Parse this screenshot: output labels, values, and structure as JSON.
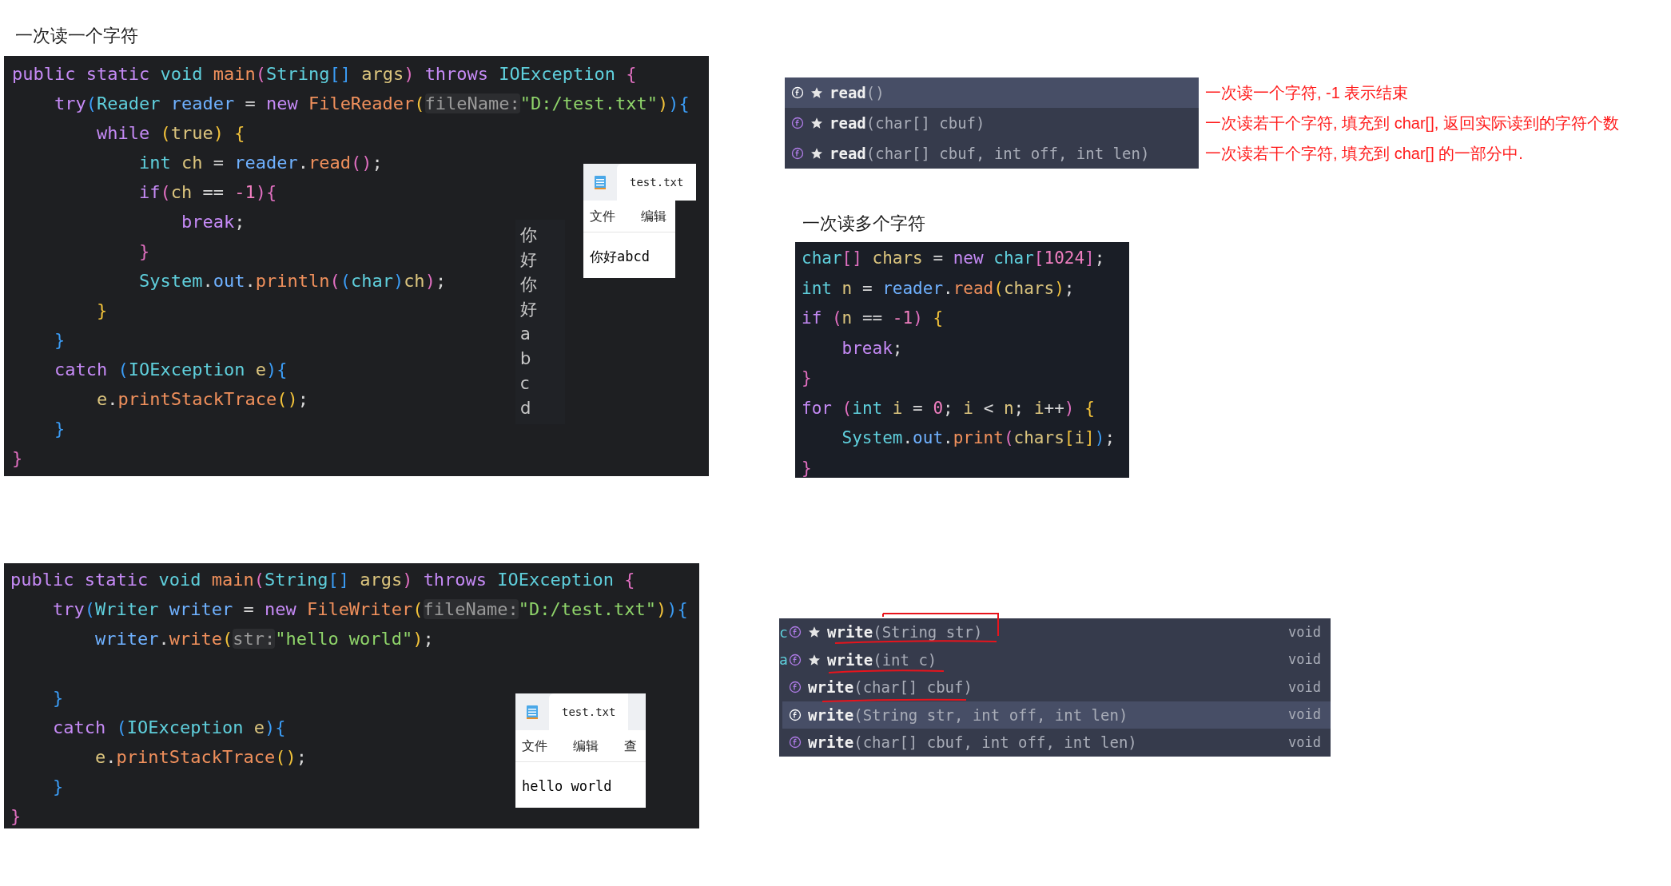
{
  "read_single": {
    "heading": "一次读一个字符",
    "code": [
      {
        "kind": "code",
        "tokens": [
          {
            "kind": "code",
            "s": "public static ",
            "color": "#c58af5"
          },
          {
            "kind": "code",
            "s": "void ",
            "color": "#5fcfdc"
          },
          {
            "kind": "code",
            "s": "main",
            "color": "#f0905c"
          },
          {
            "kind": "code",
            "s": "(",
            "color": "#e06fc0"
          },
          {
            "kind": "code",
            "s": "String",
            "color": "#5fcfdc"
          },
          {
            "kind": "code",
            "s": "[] ",
            "color": "#3b9cf5"
          },
          {
            "kind": "code",
            "s": "args",
            "color": "#dcc57e"
          },
          {
            "kind": "code",
            "s": ") ",
            "color": "#e06fc0"
          },
          {
            "kind": "code",
            "s": "throws ",
            "color": "#c58af5"
          },
          {
            "kind": "code",
            "s": "IOException ",
            "color": "#5fcfdc"
          },
          {
            "kind": "code",
            "s": "{",
            "color": "#e06fc0"
          }
        ]
      },
      {
        "kind": "code",
        "tokens": [
          {
            "kind": "code",
            "s": "    try",
            "color": "#c58af5"
          },
          {
            "kind": "code",
            "s": "(",
            "color": "#3b9cf5"
          },
          {
            "kind": "code",
            "s": "Reader ",
            "color": "#5fcfdc"
          },
          {
            "kind": "code",
            "s": "reader ",
            "color": "#6fb1ff"
          },
          {
            "kind": "code",
            "s": "= ",
            "color": "#d8d8d8"
          },
          {
            "kind": "code",
            "s": "new ",
            "color": "#c58af5"
          },
          {
            "kind": "code",
            "s": "FileReader",
            "color": "#f0905c"
          },
          {
            "kind": "code",
            "s": "(",
            "color": "#f2c23a"
          },
          {
            "kind": "hint",
            "s": "fileName:",
            "color": "#9a9a9a"
          },
          {
            "kind": "code",
            "s": "\"D:/test.txt\"",
            "color": "#8fd46a"
          },
          {
            "kind": "code",
            "s": ")",
            "color": "#f2c23a"
          },
          {
            "kind": "code",
            "s": "){",
            "color": "#3b9cf5"
          }
        ]
      },
      {
        "kind": "code",
        "tokens": [
          {
            "kind": "code",
            "s": "        while ",
            "color": "#c58af5"
          },
          {
            "kind": "code",
            "s": "(",
            "color": "#f2c23a"
          },
          {
            "kind": "code",
            "s": "true",
            "color": "#dcc57e"
          },
          {
            "kind": "code",
            "s": ") {",
            "color": "#f2c23a"
          }
        ]
      },
      {
        "kind": "code",
        "tokens": [
          {
            "kind": "code",
            "s": "            int ",
            "color": "#5fcfdc"
          },
          {
            "kind": "code",
            "s": "ch ",
            "color": "#dcc57e"
          },
          {
            "kind": "code",
            "s": "= ",
            "color": "#d8d8d8"
          },
          {
            "kind": "code",
            "s": "reader",
            "color": "#6fb1ff"
          },
          {
            "kind": "code",
            "s": ".",
            "color": "#d8d8d8"
          },
          {
            "kind": "code",
            "s": "read",
            "color": "#f0905c"
          },
          {
            "kind": "code",
            "s": "()",
            "color": "#e06fc0"
          },
          {
            "kind": "code",
            "s": ";",
            "color": "#d8d8d8"
          }
        ]
      },
      {
        "kind": "code",
        "tokens": [
          {
            "kind": "code",
            "s": "            if",
            "color": "#c58af5"
          },
          {
            "kind": "code",
            "s": "(",
            "color": "#e06fc0"
          },
          {
            "kind": "code",
            "s": "ch ",
            "color": "#dcc57e"
          },
          {
            "kind": "code",
            "s": "== ",
            "color": "#d8d8d8"
          },
          {
            "kind": "code",
            "s": "-1",
            "color": "#f07fc0"
          },
          {
            "kind": "code",
            "s": "){",
            "color": "#e06fc0"
          }
        ]
      },
      {
        "kind": "code",
        "tokens": [
          {
            "kind": "code",
            "s": "                break",
            "color": "#c58af5"
          },
          {
            "kind": "code",
            "s": ";",
            "color": "#d8d8d8"
          }
        ]
      },
      {
        "kind": "code",
        "tokens": [
          {
            "kind": "code",
            "s": "            }",
            "color": "#e06fc0"
          }
        ]
      },
      {
        "kind": "code",
        "tokens": [
          {
            "kind": "code",
            "s": "            System",
            "color": "#5fcfdc"
          },
          {
            "kind": "code",
            "s": ".",
            "color": "#d8d8d8"
          },
          {
            "kind": "code",
            "s": "out",
            "color": "#6fb1ff"
          },
          {
            "kind": "code",
            "s": ".",
            "color": "#d8d8d8"
          },
          {
            "kind": "code",
            "s": "println",
            "color": "#f0905c"
          },
          {
            "kind": "code",
            "s": "(",
            "color": "#e06fc0"
          },
          {
            "kind": "code",
            "s": "(",
            "color": "#3b9cf5"
          },
          {
            "kind": "code",
            "s": "char",
            "color": "#5fcfdc"
          },
          {
            "kind": "code",
            "s": ")",
            "color": "#3b9cf5"
          },
          {
            "kind": "code",
            "s": "ch",
            "color": "#dcc57e"
          },
          {
            "kind": "code",
            "s": ")",
            "color": "#e06fc0"
          },
          {
            "kind": "code",
            "s": ";",
            "color": "#d8d8d8"
          }
        ]
      },
      {
        "kind": "code",
        "tokens": [
          {
            "kind": "code",
            "s": "        }",
            "color": "#f2c23a"
          }
        ]
      },
      {
        "kind": "code",
        "tokens": [
          {
            "kind": "code",
            "s": "    }",
            "color": "#3b9cf5"
          }
        ]
      },
      {
        "kind": "code",
        "tokens": [
          {
            "kind": "code",
            "s": "    catch ",
            "color": "#c58af5"
          },
          {
            "kind": "code",
            "s": "(",
            "color": "#3b9cf5"
          },
          {
            "kind": "code",
            "s": "IOException ",
            "color": "#5fcfdc"
          },
          {
            "kind": "code",
            "s": "e",
            "color": "#dcc57e"
          },
          {
            "kind": "code",
            "s": "){",
            "color": "#3b9cf5"
          }
        ]
      },
      {
        "kind": "code",
        "tokens": [
          {
            "kind": "code",
            "s": "        e",
            "color": "#dcc57e"
          },
          {
            "kind": "code",
            "s": ".",
            "color": "#d8d8d8"
          },
          {
            "kind": "code",
            "s": "printStackTrace",
            "color": "#f0905c"
          },
          {
            "kind": "code",
            "s": "()",
            "color": "#f2c23a"
          },
          {
            "kind": "code",
            "s": ";",
            "color": "#d8d8d8"
          }
        ]
      },
      {
        "kind": "code",
        "tokens": [
          {
            "kind": "code",
            "s": "    }",
            "color": "#3b9cf5"
          }
        ]
      },
      {
        "kind": "code",
        "tokens": [
          {
            "kind": "code",
            "s": "}",
            "color": "#e06fc0"
          }
        ]
      }
    ],
    "console_output": [
      "你",
      "好",
      "你",
      "好",
      "a",
      "b",
      "c",
      "d"
    ],
    "notepad": {
      "title": "test.txt",
      "menu": [
        "文件",
        "编辑"
      ],
      "content": "你好abcd"
    }
  },
  "read_methods": {
    "items": [
      {
        "selected": true,
        "star": true,
        "name": "read",
        "params": "()",
        "note": "一次读一个字符, -1 表示结束"
      },
      {
        "selected": false,
        "star": true,
        "name": "read",
        "params": "(char[] cbuf)",
        "note": "一次读若干个字符, 填充到 char[], 返回实际读到的字符个数"
      },
      {
        "selected": false,
        "star": true,
        "name": "read",
        "params": "(char[] cbuf, int off, int len)",
        "note": "一次读若干个字符, 填充到 char[] 的一部分中."
      }
    ]
  },
  "read_multi": {
    "heading": "一次读多个字符",
    "code": [
      {
        "kind": "code",
        "tokens": [
          {
            "kind": "code",
            "s": "char",
            "color": "#5fcfdc"
          },
          {
            "kind": "code",
            "s": "[] ",
            "color": "#e06fc0"
          },
          {
            "kind": "code",
            "s": "chars ",
            "color": "#dcc57e"
          },
          {
            "kind": "code",
            "s": "= ",
            "color": "#d8d8d8"
          },
          {
            "kind": "code",
            "s": "new ",
            "color": "#c58af5"
          },
          {
            "kind": "code",
            "s": "char",
            "color": "#5fcfdc"
          },
          {
            "kind": "code",
            "s": "[",
            "color": "#e06fc0"
          },
          {
            "kind": "code",
            "s": "1024",
            "color": "#f07fc0"
          },
          {
            "kind": "code",
            "s": "]",
            "color": "#e06fc0"
          },
          {
            "kind": "code",
            "s": ";",
            "color": "#d8d8d8"
          }
        ]
      },
      {
        "kind": "code",
        "tokens": [
          {
            "kind": "code",
            "s": "int ",
            "color": "#5fcfdc"
          },
          {
            "kind": "code",
            "s": "n ",
            "color": "#dcc57e"
          },
          {
            "kind": "code",
            "s": "= ",
            "color": "#d8d8d8"
          },
          {
            "kind": "code",
            "s": "reader",
            "color": "#6fb1ff"
          },
          {
            "kind": "code",
            "s": ".",
            "color": "#d8d8d8"
          },
          {
            "kind": "code",
            "s": "read",
            "color": "#f0905c"
          },
          {
            "kind": "code",
            "s": "(",
            "color": "#f2c23a"
          },
          {
            "kind": "code",
            "s": "chars",
            "color": "#dcc57e"
          },
          {
            "kind": "code",
            "s": ")",
            "color": "#f2c23a"
          },
          {
            "kind": "code",
            "s": ";",
            "color": "#d8d8d8"
          }
        ]
      },
      {
        "kind": "code",
        "tokens": [
          {
            "kind": "code",
            "s": "if ",
            "color": "#c58af5"
          },
          {
            "kind": "code",
            "s": "(",
            "color": "#e06fc0"
          },
          {
            "kind": "code",
            "s": "n ",
            "color": "#dcc57e"
          },
          {
            "kind": "code",
            "s": "== ",
            "color": "#d8d8d8"
          },
          {
            "kind": "code",
            "s": "-1",
            "color": "#f07fc0"
          },
          {
            "kind": "code",
            "s": ") ",
            "color": "#e06fc0"
          },
          {
            "kind": "code",
            "s": "{",
            "color": "#f2c23a"
          }
        ]
      },
      {
        "kind": "code",
        "tokens": [
          {
            "kind": "code",
            "s": "    break",
            "color": "#c58af5"
          },
          {
            "kind": "code",
            "s": ";",
            "color": "#d8d8d8"
          }
        ]
      },
      {
        "kind": "code",
        "tokens": [
          {
            "kind": "code",
            "s": "}",
            "color": "#e06fc0"
          }
        ]
      },
      {
        "kind": "code",
        "tokens": [
          {
            "kind": "code",
            "s": "for ",
            "color": "#c58af5"
          },
          {
            "kind": "code",
            "s": "(",
            "color": "#e06fc0"
          },
          {
            "kind": "code",
            "s": "int ",
            "color": "#5fcfdc"
          },
          {
            "kind": "code",
            "s": "i ",
            "color": "#dcc57e"
          },
          {
            "kind": "code",
            "s": "= ",
            "color": "#d8d8d8"
          },
          {
            "kind": "code",
            "s": "0",
            "color": "#f07fc0"
          },
          {
            "kind": "code",
            "s": "; ",
            "color": "#d8d8d8"
          },
          {
            "kind": "code",
            "s": "i ",
            "color": "#dcc57e"
          },
          {
            "kind": "code",
            "s": "< ",
            "color": "#d8d8d8"
          },
          {
            "kind": "code",
            "s": "n",
            "color": "#dcc57e"
          },
          {
            "kind": "code",
            "s": "; ",
            "color": "#d8d8d8"
          },
          {
            "kind": "code",
            "s": "i",
            "color": "#dcc57e"
          },
          {
            "kind": "code",
            "s": "++",
            "color": "#d8d8d8"
          },
          {
            "kind": "code",
            "s": ") ",
            "color": "#e06fc0"
          },
          {
            "kind": "code",
            "s": "{",
            "color": "#f2c23a"
          }
        ]
      },
      {
        "kind": "code",
        "tokens": [
          {
            "kind": "code",
            "s": "    System",
            "color": "#5fcfdc"
          },
          {
            "kind": "code",
            "s": ".",
            "color": "#d8d8d8"
          },
          {
            "kind": "code",
            "s": "out",
            "color": "#6fb1ff"
          },
          {
            "kind": "code",
            "s": ".",
            "color": "#d8d8d8"
          },
          {
            "kind": "code",
            "s": "print",
            "color": "#f0905c"
          },
          {
            "kind": "code",
            "s": "(",
            "color": "#e06fc0"
          },
          {
            "kind": "code",
            "s": "chars",
            "color": "#dcc57e"
          },
          {
            "kind": "code",
            "s": "[",
            "color": "#f2c23a"
          },
          {
            "kind": "code",
            "s": "i",
            "color": "#dcc57e"
          },
          {
            "kind": "code",
            "s": "]",
            "color": "#f2c23a"
          },
          {
            "kind": "code",
            "s": ")",
            "color": "#3b9cf5"
          },
          {
            "kind": "code",
            "s": ";",
            "color": "#d8d8d8"
          }
        ]
      },
      {
        "kind": "code",
        "tokens": [
          {
            "kind": "code",
            "s": "}",
            "color": "#e06fc0"
          }
        ]
      }
    ]
  },
  "write_example": {
    "code": [
      {
        "kind": "code",
        "tokens": [
          {
            "kind": "code",
            "s": "public static ",
            "color": "#c58af5"
          },
          {
            "kind": "code",
            "s": "void ",
            "color": "#5fcfdc"
          },
          {
            "kind": "code",
            "s": "main",
            "color": "#f0905c"
          },
          {
            "kind": "code",
            "s": "(",
            "color": "#e06fc0"
          },
          {
            "kind": "code",
            "s": "String",
            "color": "#5fcfdc"
          },
          {
            "kind": "code",
            "s": "[] ",
            "color": "#3b9cf5"
          },
          {
            "kind": "code",
            "s": "args",
            "color": "#dcc57e"
          },
          {
            "kind": "code",
            "s": ") ",
            "color": "#e06fc0"
          },
          {
            "kind": "code",
            "s": "throws ",
            "color": "#c58af5"
          },
          {
            "kind": "code",
            "s": "IOException ",
            "color": "#5fcfdc"
          },
          {
            "kind": "code",
            "s": "{",
            "color": "#e06fc0"
          }
        ]
      },
      {
        "kind": "code",
        "tokens": [
          {
            "kind": "code",
            "s": "    try",
            "color": "#c58af5"
          },
          {
            "kind": "code",
            "s": "(",
            "color": "#3b9cf5"
          },
          {
            "kind": "code",
            "s": "Writer ",
            "color": "#5fcfdc"
          },
          {
            "kind": "code",
            "s": "writer ",
            "color": "#6fb1ff"
          },
          {
            "kind": "code",
            "s": "= ",
            "color": "#d8d8d8"
          },
          {
            "kind": "code",
            "s": "new ",
            "color": "#c58af5"
          },
          {
            "kind": "code",
            "s": "FileWriter",
            "color": "#f0905c"
          },
          {
            "kind": "code",
            "s": "(",
            "color": "#f2c23a"
          },
          {
            "kind": "hint",
            "s": "fileName:",
            "color": "#9a9a9a"
          },
          {
            "kind": "code",
            "s": "\"D:/test.txt\"",
            "color": "#8fd46a"
          },
          {
            "kind": "code",
            "s": ")",
            "color": "#f2c23a"
          },
          {
            "kind": "code",
            "s": "){",
            "color": "#3b9cf5"
          }
        ]
      },
      {
        "kind": "code",
        "tokens": [
          {
            "kind": "code",
            "s": "        writer",
            "color": "#6fb1ff"
          },
          {
            "kind": "code",
            "s": ".",
            "color": "#d8d8d8"
          },
          {
            "kind": "code",
            "s": "write",
            "color": "#f0905c"
          },
          {
            "kind": "code",
            "s": "(",
            "color": "#f2c23a"
          },
          {
            "kind": "hint",
            "s": "str:",
            "color": "#9a9a9a"
          },
          {
            "kind": "code",
            "s": "\"hello world\"",
            "color": "#8fd46a"
          },
          {
            "kind": "code",
            "s": ")",
            "color": "#f2c23a"
          },
          {
            "kind": "code",
            "s": ";",
            "color": "#d8d8d8"
          }
        ]
      },
      {
        "kind": "blank"
      },
      {
        "kind": "code",
        "tokens": [
          {
            "kind": "code",
            "s": "    }",
            "color": "#3b9cf5"
          }
        ]
      },
      {
        "kind": "code",
        "tokens": [
          {
            "kind": "code",
            "s": "    catch ",
            "color": "#c58af5"
          },
          {
            "kind": "code",
            "s": "(",
            "color": "#3b9cf5"
          },
          {
            "kind": "code",
            "s": "IOException ",
            "color": "#5fcfdc"
          },
          {
            "kind": "code",
            "s": "e",
            "color": "#dcc57e"
          },
          {
            "kind": "code",
            "s": "){",
            "color": "#3b9cf5"
          }
        ]
      },
      {
        "kind": "code",
        "tokens": [
          {
            "kind": "code",
            "s": "        e",
            "color": "#dcc57e"
          },
          {
            "kind": "code",
            "s": ".",
            "color": "#d8d8d8"
          },
          {
            "kind": "code",
            "s": "printStackTrace",
            "color": "#f0905c"
          },
          {
            "kind": "code",
            "s": "()",
            "color": "#f2c23a"
          },
          {
            "kind": "code",
            "s": ";",
            "color": "#d8d8d8"
          }
        ]
      },
      {
        "kind": "code",
        "tokens": [
          {
            "kind": "code",
            "s": "    }",
            "color": "#3b9cf5"
          }
        ]
      },
      {
        "kind": "code",
        "tokens": [
          {
            "kind": "code",
            "s": "}",
            "color": "#e06fc0"
          }
        ]
      }
    ],
    "notepad": {
      "title": "test.txt",
      "menu": [
        "文件",
        "编辑",
        "查"
      ],
      "content": "hello world"
    }
  },
  "write_methods": {
    "items": [
      {
        "selected": false,
        "star": true,
        "edge": "c",
        "name": "write",
        "params": "(String str)",
        "return": "void"
      },
      {
        "selected": false,
        "star": true,
        "edge": "a",
        "name": "write",
        "params": "(int c)",
        "return": "void"
      },
      {
        "selected": false,
        "star": false,
        "name": "write",
        "params": "(char[] cbuf)",
        "return": "void"
      },
      {
        "selected": true,
        "star": false,
        "name": "write",
        "params": "(String str, int off, int len)",
        "return": "void"
      },
      {
        "selected": false,
        "star": false,
        "name": "write",
        "params": "(char[] cbuf, int off, int len)",
        "return": "void"
      }
    ]
  }
}
